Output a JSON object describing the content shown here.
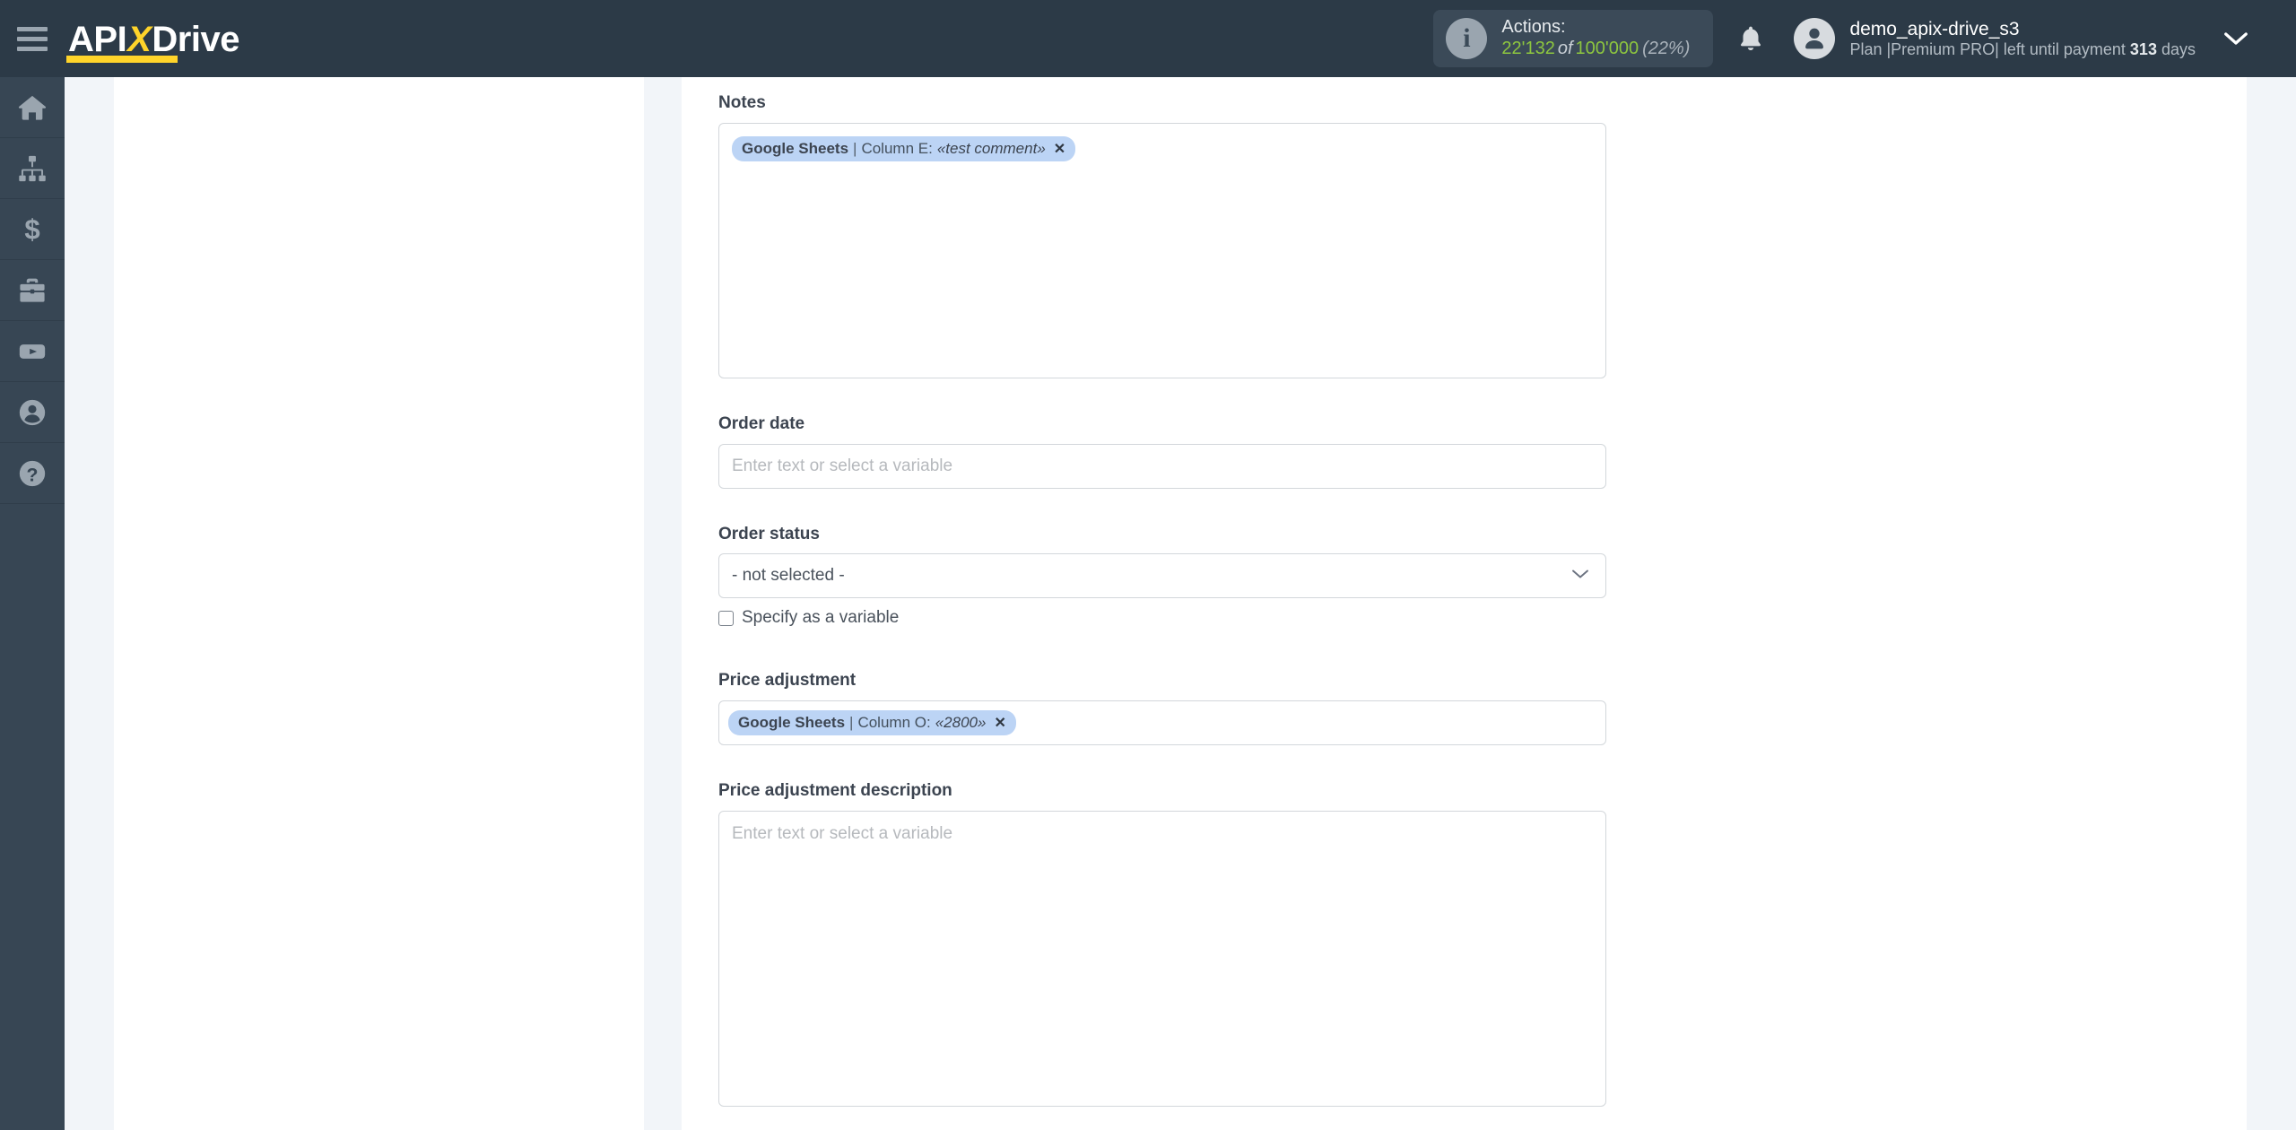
{
  "header": {
    "menu_icon": "hamburger-menu-icon",
    "logo": {
      "part1": "API",
      "x": "X",
      "part2": "Drive"
    },
    "actions": {
      "icon": "info-icon",
      "title": "Actions:",
      "used": "22'132",
      "of": "of",
      "total": "100'000",
      "percent": "(22%)"
    },
    "notifications_icon": "bell-icon",
    "user": {
      "avatar_icon": "user-avatar-icon",
      "name": "demo_apix-drive_s3",
      "plan_prefix": "Plan |Premium PRO| left until payment ",
      "plan_days": "313",
      "plan_suffix": " days"
    },
    "caret_icon": "chevron-down-icon"
  },
  "sidebar": {
    "items": [
      {
        "name": "home",
        "icon": "home-icon"
      },
      {
        "name": "connections",
        "icon": "sitemap-icon"
      },
      {
        "name": "billing",
        "icon": "dollar-icon"
      },
      {
        "name": "tools",
        "icon": "briefcase-icon"
      },
      {
        "name": "video",
        "icon": "youtube-icon"
      },
      {
        "name": "account",
        "icon": "user-circle-icon"
      },
      {
        "name": "help",
        "icon": "question-circle-icon"
      }
    ]
  },
  "form": {
    "notes": {
      "label": "Notes",
      "chip": {
        "source": "Google Sheets",
        "separator": "|",
        "column": "Column E:",
        "value": "«test comment»",
        "remove": "✕"
      }
    },
    "order_date": {
      "label": "Order date",
      "value": "",
      "placeholder": "Enter text or select a variable"
    },
    "order_status": {
      "label": "Order status",
      "selected": "- not selected -",
      "caret": "chevron-down-icon",
      "checkbox_label": "Specify as a variable",
      "checked": false
    },
    "price_adjustment": {
      "label": "Price adjustment",
      "chip": {
        "source": "Google Sheets",
        "separator": "|",
        "column": "Column O:",
        "value": "«2800»",
        "remove": "✕"
      }
    },
    "price_adjustment_description": {
      "label": "Price adjustment description",
      "value": "",
      "placeholder": "Enter text or select a variable"
    }
  },
  "colors": {
    "header_bg": "#2c3a47",
    "rail_bg": "#374654",
    "accent_yellow": "#ffd42a",
    "accent_green": "#8dc63f",
    "chip_bg": "#bcd4f5",
    "page_bg": "#f2f5f9"
  }
}
